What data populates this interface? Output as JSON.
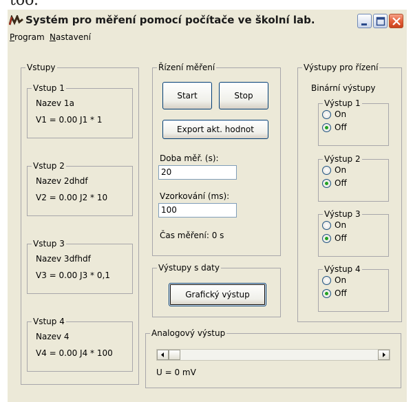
{
  "clipped_text": "too.",
  "window": {
    "title": "Systém pro měření pomocí počítače ve školní lab."
  },
  "menu": [
    {
      "label": "Program"
    },
    {
      "label": "Nastavení"
    }
  ],
  "inputs_group": {
    "title": "Vstupy",
    "items": [
      {
        "title": "Vstup 1",
        "name": "Nazev 1a",
        "value": "V1 = 0.00 J1 * 1"
      },
      {
        "title": "Vstup 2",
        "name": "Nazev 2dhdf",
        "value": "V2 = 0.00 J2 * 10"
      },
      {
        "title": "Vstup 3",
        "name": "Nazev 3dfhdf",
        "value": "V3 = 0.00 J3 * 0,1"
      },
      {
        "title": "Vstup 4",
        "name": "Nazev 4",
        "value": "V4 = 0.00 J4 * 100"
      }
    ]
  },
  "control_group": {
    "title": "Řízení měření",
    "start_label": "Start",
    "stop_label": "Stop",
    "export_label": "Export akt. hodnot",
    "duration_label": "Doba měř. (s):",
    "duration_value": "20",
    "sampling_label": "Vzorkování (ms):",
    "sampling_value": "100",
    "elapsed": "Čas měření: 0 s"
  },
  "data_output_group": {
    "title": "Výstupy s daty",
    "graph_label": "Grafický výstup"
  },
  "analog_group": {
    "title": "Analogový výstup",
    "voltage": "U = 0 mV",
    "slider_level": 0
  },
  "outputs_group": {
    "title": "Výstupy pro řízení",
    "subtitle": "Binární výstupy",
    "on_label": "On",
    "off_label": "Off",
    "outputs": [
      {
        "title": "Výstup 1",
        "state": "Off"
      },
      {
        "title": "Výstup 2",
        "state": "Off"
      },
      {
        "title": "Výstup 3",
        "state": "Off"
      },
      {
        "title": "Výstup 4",
        "state": "Off"
      }
    ]
  },
  "colors": {
    "face": "#ece9d8",
    "close_button": "#e5603a",
    "radio_dot": "#21a121"
  }
}
